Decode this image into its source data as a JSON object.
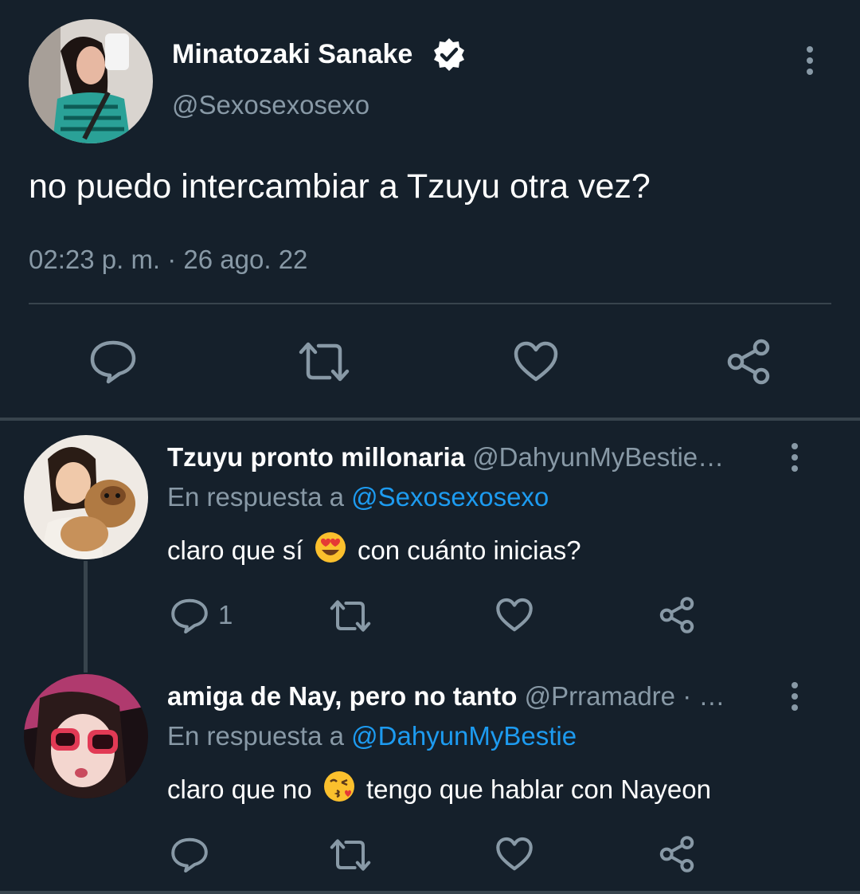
{
  "main_tweet": {
    "display_name": "Minatozaki Sanake",
    "handle": "@Sexosexosexo",
    "text": "no puedo intercambiar a Tzuyu otra vez?",
    "timestamp": "02:23 p. m. · 26 ago. 22"
  },
  "replies": [
    {
      "display_name": "Tzuyu pronto millonaria",
      "handle": "@DahyunMyBestie…",
      "reply_prefix": "En respuesta a",
      "reply_to": "@Sexosexosexo",
      "text_before": "claro que sí",
      "emoji": "smiling-face-with-heart-eyes",
      "text_after": "con cuánto inicias?",
      "reply_count": "1"
    },
    {
      "display_name": "amiga de Nay, pero no tanto",
      "handle": "@Prramadre · …",
      "reply_prefix": "En respuesta a",
      "reply_to": "@DahyunMyBestie",
      "text_before": "claro que no",
      "emoji": "face-blowing-a-kiss",
      "text_after": "tengo que hablar con Nayeon",
      "reply_count": ""
    }
  ],
  "colors": {
    "background": "#15202b",
    "secondary_text": "#8899a6",
    "link": "#1d9bf0",
    "divider": "#38444d"
  }
}
